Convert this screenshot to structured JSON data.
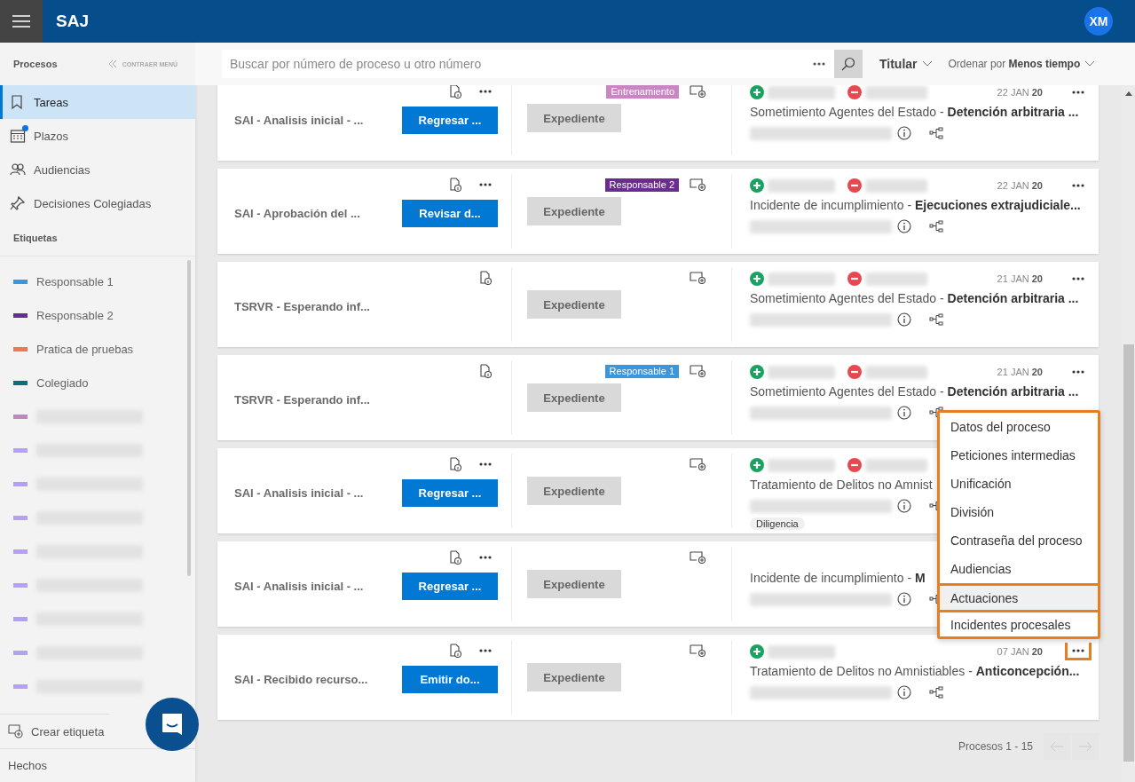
{
  "app": {
    "title": "SAJ",
    "avatar": "XM"
  },
  "sidebar": {
    "section": "Procesos",
    "collapse": "CONTRAER MENÚ",
    "nav": [
      {
        "label": "Tareas",
        "kind": "bookmark",
        "selected": true,
        "notification": false
      },
      {
        "label": "Plazos",
        "kind": "calendar",
        "selected": false,
        "notification": true
      },
      {
        "label": "Audiencias",
        "kind": "people",
        "selected": false,
        "notification": false
      },
      {
        "label": "Decisiones Colegiadas",
        "kind": "pin",
        "selected": false,
        "notification": false
      }
    ],
    "labels_title": "Etiquetas",
    "labels": [
      {
        "kind": "text",
        "label": "Responsable 1",
        "color": "#3a96dd"
      },
      {
        "kind": "text",
        "label": "Responsable 2",
        "color": "#6b2c8f"
      },
      {
        "kind": "text",
        "label": "Pratica de pruebas",
        "color": "#f07850"
      },
      {
        "kind": "text",
        "label": "Colegiado",
        "color": "#0a6e7c"
      },
      {
        "kind": "redacted",
        "color": "#c586c0"
      },
      {
        "kind": "redacted",
        "color": "#b4a0f8"
      },
      {
        "kind": "redacted",
        "color": "#b4a0f8"
      },
      {
        "kind": "redacted",
        "color": "#b4a0f8"
      },
      {
        "kind": "redacted",
        "color": "#b4a0f8"
      },
      {
        "kind": "redacted",
        "color": "#b4a0f8"
      },
      {
        "kind": "redacted",
        "color": "#b4a0f8"
      },
      {
        "kind": "redacted",
        "color": "#b4a0f8"
      },
      {
        "kind": "redacted",
        "color": "#b4a0f8"
      }
    ],
    "create_label": "Crear etiqueta",
    "footer": "Hechos"
  },
  "toolbar": {
    "search_placeholder": "Buscar por número de proceso u otro número",
    "filter": "Titular",
    "sort": "Ordenar por **Menos tiempo**"
  },
  "cards": [
    {
      "title": "SAI - Analisis inicial - ...",
      "action": "Regresar ...",
      "more_left": true,
      "tag": {
        "label": "Entrenamiento",
        "color": "#c986c2"
      },
      "file": "Expediente",
      "participants": [
        {
          "kind": "plus"
        },
        {
          "kind": "minus"
        }
      ],
      "date": "22 JAN **20**",
      "more_right": true,
      "description": "Sometimiento Agentes del Estado - **Detención arbitraria ...**",
      "menu_open": false
    },
    {
      "title": "SAI - Aprobación del ...",
      "action": "Revisar d...",
      "more_left": true,
      "tag": {
        "label": "Responsable 2",
        "color": "#6b2c8f"
      },
      "file": "Expediente",
      "participants": [
        {
          "kind": "plus"
        },
        {
          "kind": "minus"
        }
      ],
      "date": "22 JAN **20**",
      "more_right": true,
      "description": "Incidente de incumplimiento - **Ejecuciones extrajudiciale...**",
      "menu_open": false
    },
    {
      "title": "TSRVR - Esperando inf...",
      "more_left": false,
      "file": "Expediente",
      "participants": [
        {
          "kind": "plus"
        },
        {
          "kind": "minus"
        }
      ],
      "date": "21 JAN **20**",
      "more_right": true,
      "description": "Sometimiento Agentes del Estado - **Detención arbitraria ...**",
      "menu_open": false
    },
    {
      "title": "TSRVR - Esperando inf...",
      "more_left": false,
      "tag": {
        "label": "Responsable 1",
        "color": "#3a96dd"
      },
      "file": "Expediente",
      "participants": [
        {
          "kind": "plus"
        },
        {
          "kind": "minus"
        }
      ],
      "date": "21 JAN **20**",
      "more_right": true,
      "description": "Sometimiento Agentes del Estado - **Detención arbitraria ...**",
      "menu_open": false
    },
    {
      "title": "SAI - Analisis inicial - ...",
      "action": "Regresar ...",
      "more_left": true,
      "file": "Expediente",
      "participants": [
        {
          "kind": "plus"
        },
        {
          "kind": "minus"
        }
      ],
      "more_right": false,
      "description": "Tratamiento de Delitos no Amnist",
      "chip": "Diligencia",
      "menu_open": false
    },
    {
      "title": "SAI - Analisis inicial - ...",
      "action": "Regresar ...",
      "more_left": true,
      "file": "Expediente",
      "more_right": false,
      "description": "Incidente de incumplimiento - **M**",
      "menu_open": false
    },
    {
      "title": "SAI - Recibido recurso...",
      "action": "Emitir do...",
      "more_left": true,
      "file": "Expediente",
      "participants": [
        {
          "kind": "plus"
        }
      ],
      "date": "07 JAN **20**",
      "more_right": true,
      "description": "Tratamiento de Delitos no Amnistiables - **Anticoncepción...**",
      "menu_open": true
    }
  ],
  "context_menu": {
    "items": [
      {
        "label": "Datos del proceso",
        "selected": false,
        "separated": false
      },
      {
        "label": "Peticiones intermedias",
        "selected": false,
        "separated": false
      },
      {
        "label": "Unificación",
        "selected": false,
        "separated": false
      },
      {
        "label": "División",
        "selected": false,
        "separated": false
      },
      {
        "label": "Contraseña del proceso",
        "selected": false,
        "separated": false
      },
      {
        "label": "Audiencias",
        "selected": false,
        "separated": false
      },
      {
        "label": "Actuaciones",
        "selected": true,
        "separated": true
      },
      {
        "label": "Incidentes procesales",
        "selected": false,
        "separated": true
      }
    ]
  },
  "pagination": {
    "range": "Procesos 1 - 15",
    "prev_disabled": true,
    "next_disabled": true
  }
}
